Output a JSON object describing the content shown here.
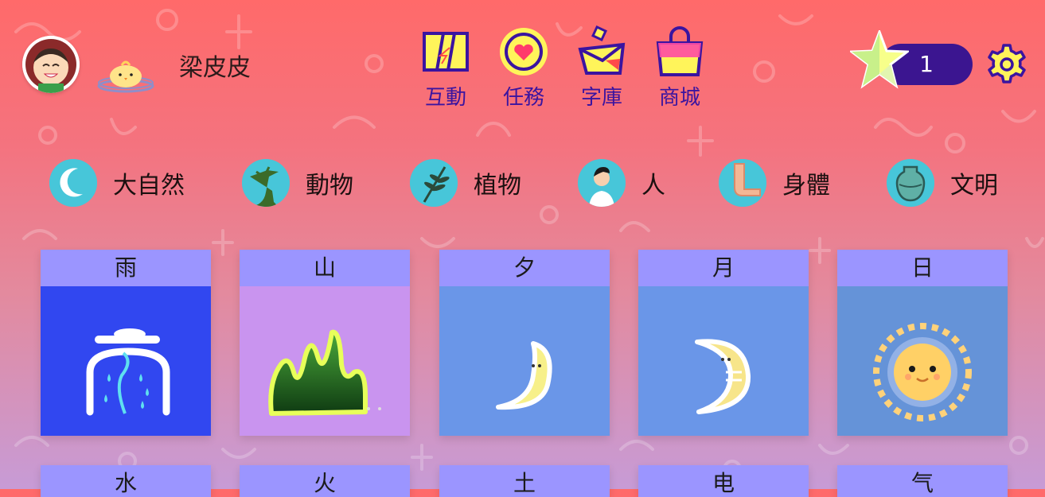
{
  "user": {
    "name": "梁皮皮"
  },
  "nav": [
    {
      "label": "互動",
      "icon": "interaction-icon"
    },
    {
      "label": "任務",
      "icon": "task-icon"
    },
    {
      "label": "字庫",
      "icon": "word-library-icon"
    },
    {
      "label": "商城",
      "icon": "shop-icon"
    }
  ],
  "stars": {
    "count": "1"
  },
  "categories": [
    {
      "label": "大自然",
      "icon": "moon-icon"
    },
    {
      "label": "動物",
      "icon": "dinosaur-icon"
    },
    {
      "label": "植物",
      "icon": "plant-icon"
    },
    {
      "label": "人",
      "icon": "person-icon"
    },
    {
      "label": "身體",
      "icon": "body-icon"
    },
    {
      "label": "文明",
      "icon": "vase-icon"
    }
  ],
  "cards": [
    {
      "char": "雨",
      "bg": "#3147f0",
      "icon": "rain-icon"
    },
    {
      "char": "山",
      "bg": "#c994ef",
      "icon": "mountain-icon"
    },
    {
      "char": "夕",
      "bg": "#6a96e8",
      "icon": "crescent-moon-icon"
    },
    {
      "char": "月",
      "bg": "#6a96e8",
      "icon": "moon-icon"
    },
    {
      "char": "日",
      "bg": "#6593d8",
      "icon": "sun-icon"
    },
    {
      "char": "水"
    },
    {
      "char": "火"
    },
    {
      "char": "土"
    },
    {
      "char": "电"
    },
    {
      "char": "气"
    }
  ],
  "colors": {
    "nav_text": "#3a14a0",
    "card_header": "#9b95ff",
    "pill": "#3b1590"
  }
}
